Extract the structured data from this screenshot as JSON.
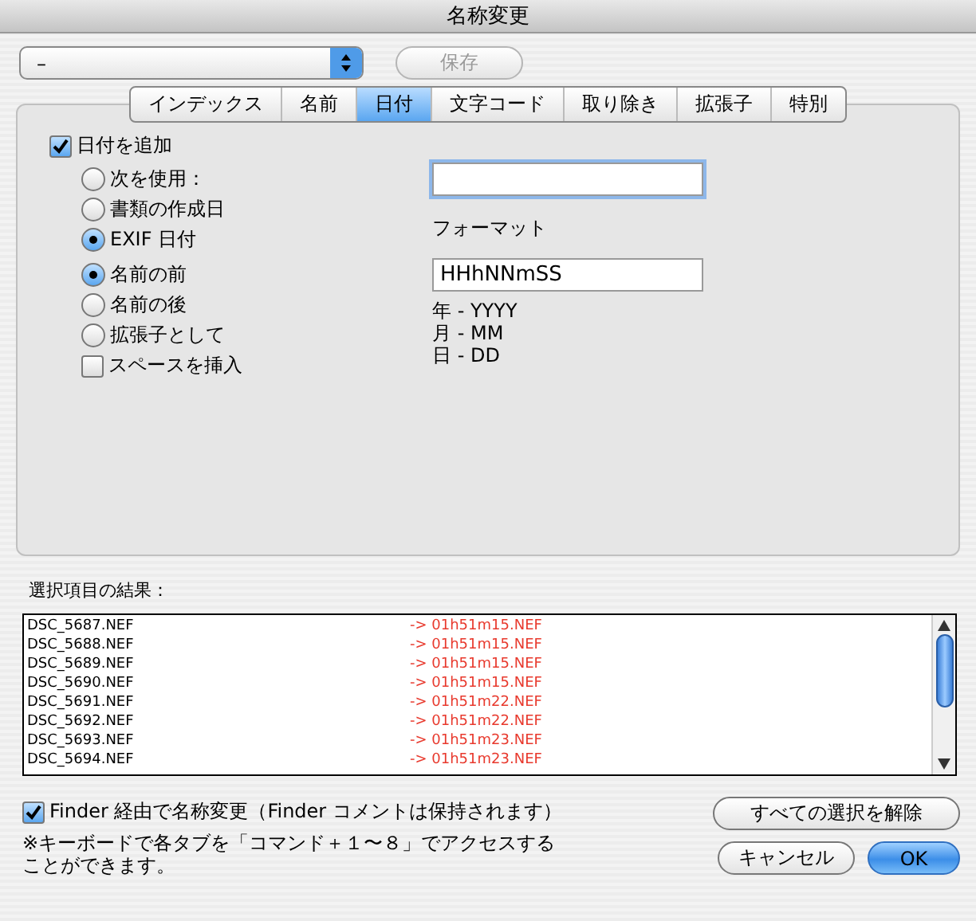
{
  "window": {
    "title": "名称変更"
  },
  "preset": {
    "value": "–"
  },
  "save_button": {
    "label": "保存",
    "disabled": true
  },
  "tabs": [
    {
      "label": "インデックス",
      "selected": false
    },
    {
      "label": "名前",
      "selected": false
    },
    {
      "label": "日付",
      "selected": true
    },
    {
      "label": "文字コード",
      "selected": false
    },
    {
      "label": "取り除き",
      "selected": false
    },
    {
      "label": "拡張子",
      "selected": false
    },
    {
      "label": "特別",
      "selected": false
    }
  ],
  "add_date": {
    "label": "日付を追加",
    "checked": true
  },
  "date_source": [
    {
      "label": "次を使用：",
      "selected": false
    },
    {
      "label": "書類の作成日",
      "selected": false
    },
    {
      "label": "EXIF 日付",
      "selected": true
    }
  ],
  "position": [
    {
      "label": "名前の前",
      "selected": true
    },
    {
      "label": "名前の後",
      "selected": false
    },
    {
      "label": "拡張子として",
      "selected": false
    }
  ],
  "insert_space": {
    "label": "スペースを挿入",
    "checked": false
  },
  "format_label": "フォーマット",
  "format": {
    "value": "HHhNNmSS"
  },
  "format_help": [
    "年 - YYYY",
    "月 - MM",
    "日 - DD"
  ],
  "results_label": "選択項目の結果：",
  "results": [
    {
      "original": "DSC_5687.NEF",
      "renamed": "-> 01h51m15.NEF"
    },
    {
      "original": "DSC_5688.NEF",
      "renamed": "-> 01h51m15.NEF"
    },
    {
      "original": "DSC_5689.NEF",
      "renamed": "-> 01h51m15.NEF"
    },
    {
      "original": "DSC_5690.NEF",
      "renamed": "-> 01h51m15.NEF"
    },
    {
      "original": "DSC_5691.NEF",
      "renamed": "-> 01h51m22.NEF"
    },
    {
      "original": "DSC_5692.NEF",
      "renamed": "-> 01h51m22.NEF"
    },
    {
      "original": "DSC_5693.NEF",
      "renamed": "-> 01h51m23.NEF"
    },
    {
      "original": "DSC_5694.NEF",
      "renamed": "-> 01h51m23.NEF"
    }
  ],
  "finder_rename": {
    "label": "Finder 経由で名称変更（Finder コメントは保持されます）",
    "checked": true
  },
  "note": "※キーボードで各タブを「コマンド＋１〜８」でアクセスすることができます。",
  "buttons": {
    "deselect_all": "すべての選択を解除",
    "cancel": "キャンセル",
    "ok": "OK"
  }
}
